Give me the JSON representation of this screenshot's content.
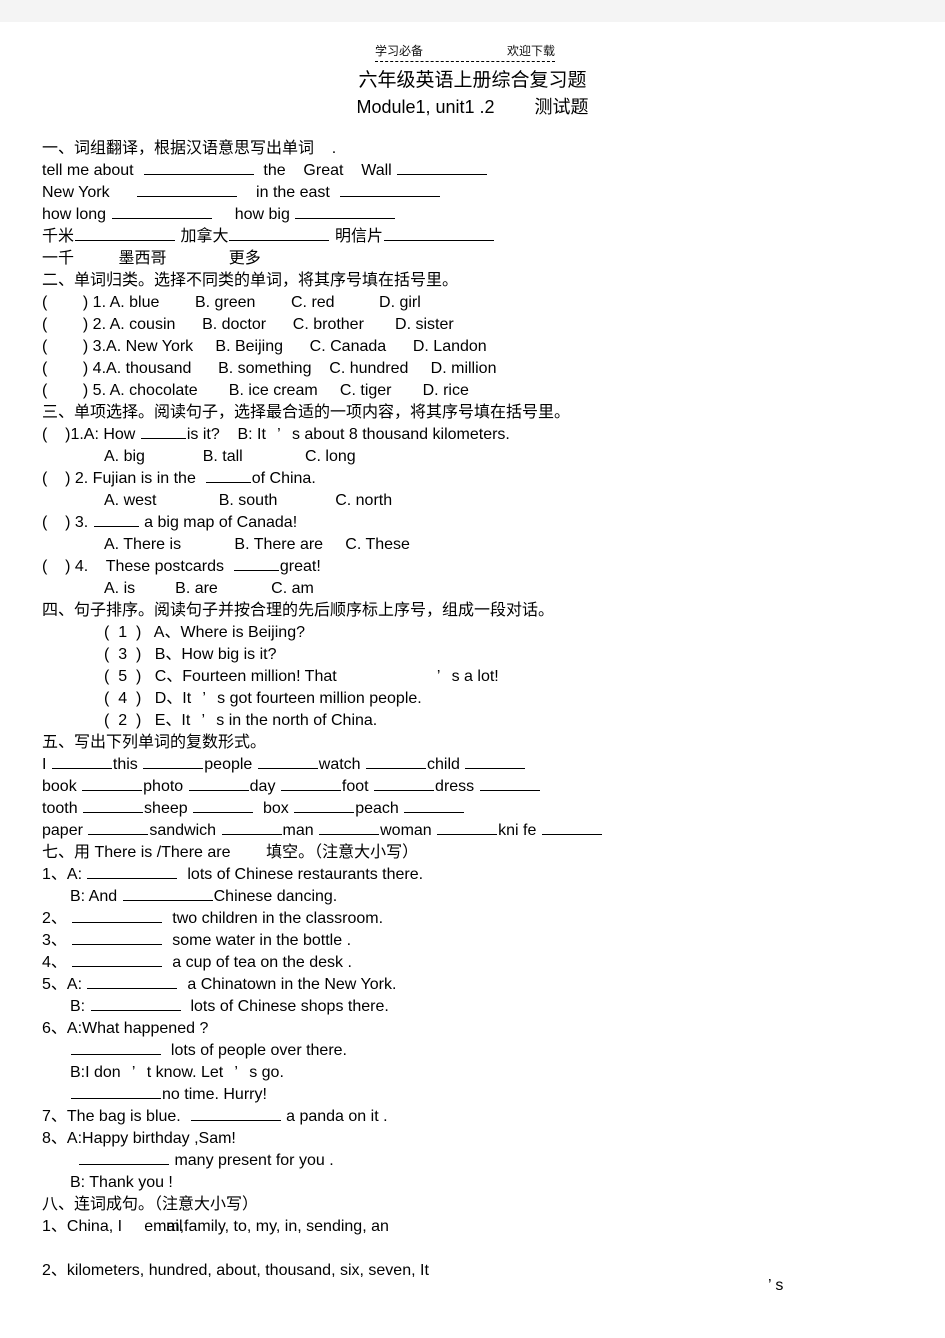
{
  "header": {
    "watermark_left": "学习必备",
    "watermark_right": "欢迎下载"
  },
  "title": {
    "line1": "六年级英语上册综合复习题",
    "line2_left": "Module1, unit1 .2",
    "line2_right": "测试题"
  },
  "section1": {
    "heading": "一、词组翻译，根据汉语意思写出单词    .",
    "rows": [
      {
        "a": "tell me about",
        "b": "the    Great    Wall"
      },
      {
        "a": "New York",
        "b": "in the east"
      },
      {
        "a": "how long",
        "b": "how big"
      },
      {
        "a": "千米",
        "b": "加拿大",
        "c": "明信片"
      },
      {
        "a": "一千",
        "b": "墨西哥",
        "c": "更多"
      }
    ]
  },
  "section2": {
    "heading": "二、单词归类。选择不同类的单词，将其序号填在括号里。",
    "items": [
      {
        "num": "1.",
        "a": "A. blue",
        "b": "B. green",
        "c": "C. red",
        "d": "D. girl"
      },
      {
        "num": "2.",
        "a": "A. cousin",
        "b": "B. doctor",
        "c": "C. brother",
        "d": "D. sister"
      },
      {
        "num": "3.",
        "a": "A. New York",
        "b": "B. Beijing",
        "c": "C. Canada",
        "d": "D. Landon"
      },
      {
        "num": "4.",
        "a": "A. thousand",
        "b": "B. something",
        "c": "C. hundred",
        "d": "D. million"
      },
      {
        "num": "5.",
        "a": "A. chocolate",
        "b": "B. ice cream",
        "c": "C. tiger",
        "d": "D. rice"
      }
    ]
  },
  "section3": {
    "heading": "三、单项选择。阅读句子，选择最合适的一项内容，将其序号填在括号里。",
    "q1": {
      "stem_a": ")1.A: How",
      "stem_b": "is it?    B: It",
      "apos": "’",
      "stem_c": "s about 8 thousand kilometers.",
      "opt_a": "A. big",
      "opt_b": "B. tall",
      "opt_c": "C. long"
    },
    "q2": {
      "stem_a": ") 2. Fujian is in the",
      "stem_b": "of China.",
      "opt_a": "A. west",
      "opt_b": "B. south",
      "opt_c": "C. north"
    },
    "q3": {
      "stem_a": ") 3.",
      "stem_b": "a big map of Canada!",
      "opt_a": "A. There is",
      "opt_b": "B. There are",
      "opt_c": "C. These"
    },
    "q4": {
      "stem_a": ") 4.    These postcards",
      "stem_b": "great!",
      "opt_a": "A. is",
      "opt_b": "B. are",
      "opt_c": "C. am"
    }
  },
  "section4": {
    "heading": "四、句子排序。阅读句子并按合理的先后顺序标上序号，组成一段对话。",
    "items": [
      {
        "num": "1",
        "label": "A、",
        "text": "Where is Beijing?",
        "apos": "",
        "tail": ""
      },
      {
        "num": "3",
        "label": "B、",
        "text": "How big is it?",
        "apos": "",
        "tail": ""
      },
      {
        "num": "5",
        "label": "C、",
        "text": "Fourteen million! That",
        "apos": "’",
        "tail": "s a lot!"
      },
      {
        "num": "4",
        "label": "D、",
        "text": "It",
        "apos": "’",
        "tail": "s got fourteen million people."
      },
      {
        "num": "2",
        "label": "E、",
        "text": "It",
        "apos": "’",
        "tail": "s in the north of China."
      }
    ]
  },
  "section5": {
    "heading": "五、写出下列单词的复数形式。",
    "line1": [
      "I",
      "this",
      "people",
      "watch",
      "child"
    ],
    "line2": [
      "book",
      "photo",
      "day",
      "foot",
      "dress"
    ],
    "line3": [
      "tooth",
      "sheep",
      "box",
      "peach"
    ],
    "line4": [
      "paper",
      "sandwich",
      "man",
      "woman",
      "kni fe"
    ]
  },
  "section7": {
    "heading": "七、用 There is /There are        填空。（注意大小写）",
    "items": [
      {
        "prefix": "1、A:",
        "text": "lots of Chinese restaurants there."
      },
      {
        "prefix": "B: And",
        "text": "Chinese dancing.",
        "indent": true
      },
      {
        "prefix": "2、",
        "text": "two children in the classroom."
      },
      {
        "prefix": "3、",
        "text": "some water in the bottle ."
      },
      {
        "prefix": "4、",
        "text": "a cup of tea on the desk ."
      },
      {
        "prefix": "5、A:",
        "text": "a Chinatown in the New York."
      },
      {
        "prefix": "B:",
        "text": "lots of Chinese shops there.",
        "indent": true
      }
    ],
    "q6_a": "6、A:What happened ?",
    "q6_b": "lots of people over there.",
    "q6_c_1": "B:I don",
    "q6_c_apos": "’",
    "q6_c_2": "t know. Let",
    "q6_c_apos2": "’",
    "q6_c_3": "s go.",
    "q6_d": "no time. Hurry!",
    "q7_a": "7、The bag is blue.",
    "q7_b": "a panda on it .",
    "q8_a": "8、A:Happy birthday ,Sam!",
    "q8_b": "many present for you .",
    "q8_c": "B: Thank you !"
  },
  "section8": {
    "heading": "八、连词成句。（注意大小写）",
    "q1_num": "1、",
    "q1_under": "China, I",
    "q1_email": "email",
    "q1_rest": "m,family, to, my, in, sending, an",
    "q2": "2、kilometers, hundred, about, thousand, six, seven, It",
    "tail_apos": "’ s"
  }
}
